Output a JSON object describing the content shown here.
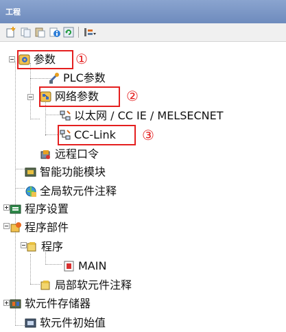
{
  "window": {
    "title": "工程"
  },
  "toolbar": {
    "icons": [
      "new-item-icon",
      "copy-icon",
      "paste-icon",
      "properties-icon",
      "refresh-icon",
      "display-options-icon"
    ]
  },
  "tree": {
    "parameters": "参数",
    "plc_parameters": "PLC参数",
    "network_parameters": "网络参数",
    "ethernet": "以太网 / CC IE / MELSECNET",
    "cclink": "CC-Link",
    "remote_password": "远程口令",
    "intelligent_module": "智能功能模块",
    "global_comment": "全局软元件注释",
    "program_setting": "程序设置",
    "program_parts": "程序部件",
    "program": "程序",
    "main": "MAIN",
    "local_comment": "局部软元件注释",
    "device_memory": "软元件存储器",
    "device_init": "软元件初始值"
  },
  "annotations": {
    "marker_1": "①",
    "marker_2": "②",
    "marker_3": "③",
    "color": "#e41e1e"
  }
}
